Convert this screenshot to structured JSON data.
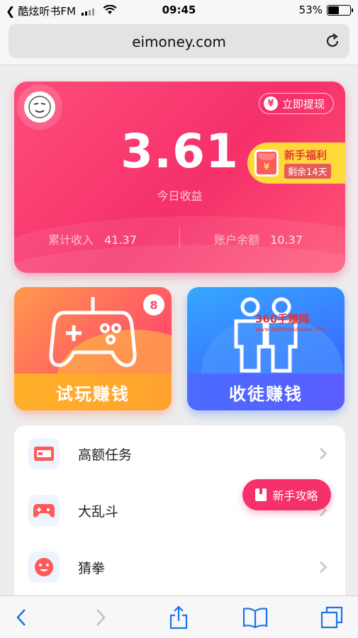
{
  "status_bar": {
    "carrier": "酷炫听书FM",
    "time": "09:45",
    "battery": "53%",
    "battery_level": 0.53
  },
  "browser": {
    "url": "eimoney.com"
  },
  "earnings_card": {
    "withdraw_label": "立即提现",
    "today_value": "3.61",
    "today_label": "今日收益",
    "total_income_label": "累计收入",
    "total_income_value": "41.37",
    "balance_label": "账户余额",
    "balance_value": "10.37",
    "newbie_title": "新手福利",
    "newbie_sub": "剩余14天",
    "yen_symbol": "¥"
  },
  "tiles": {
    "trial": {
      "label": "试玩赚钱",
      "badge": "8"
    },
    "recruit": {
      "label": "收徒赚钱",
      "watermark": "360手赚网",
      "watermark_url": "www.360shouzhuan.com"
    }
  },
  "list": {
    "items": [
      {
        "label": "高额任务",
        "icon": "high-reward-task-icon"
      },
      {
        "label": "大乱斗",
        "icon": "gamepad-icon"
      },
      {
        "label": "猜拳",
        "icon": "smiley-icon"
      }
    ]
  },
  "guide_button": {
    "label": "新手攻略"
  },
  "colors": {
    "primary": "#f5306a",
    "trial_orange": "#ffa22e",
    "recruit_blue": "#4a6cff",
    "newbie_yellow": "#ffd83a"
  }
}
